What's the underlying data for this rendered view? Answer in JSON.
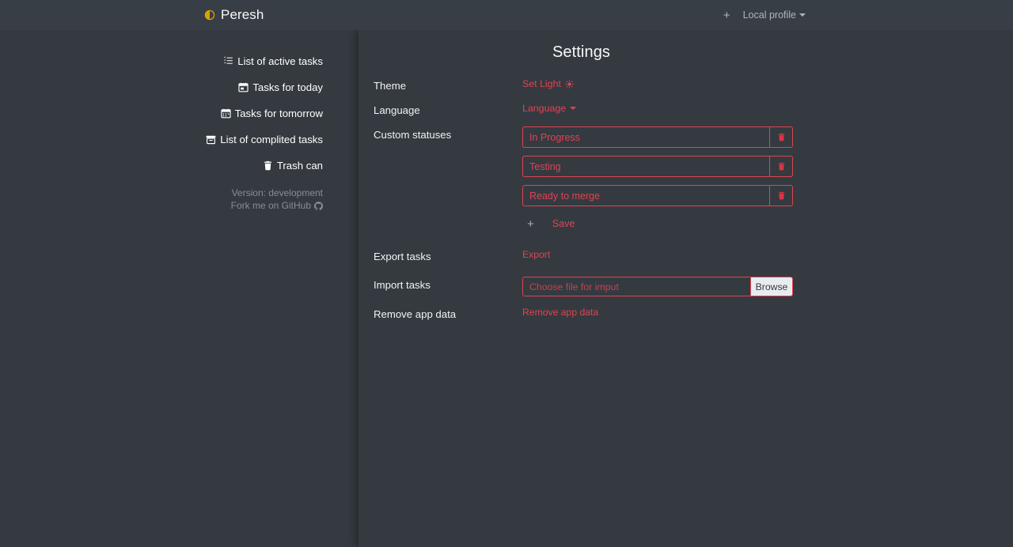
{
  "navbar": {
    "brand": "Peresh",
    "brand_icon": "adjust-circle-icon",
    "add_icon": "plus-icon",
    "profile_label": "Local profile",
    "profile_caret_icon": "caret-down-icon",
    "brand_color": "#e0a800"
  },
  "sidebar": {
    "items": [
      {
        "label": "List of active tasks",
        "icon": "list-check-icon"
      },
      {
        "label": "Tasks for today",
        "icon": "calendar-day-icon"
      },
      {
        "label": "Tasks for tomorrow",
        "icon": "calendar-icon"
      },
      {
        "label": "List of complited tasks",
        "icon": "archive-icon"
      },
      {
        "label": "Trash can",
        "icon": "trash-icon"
      }
    ],
    "version": "Version: development",
    "fork_label": "Fork me on GitHub",
    "fork_icon": "github-icon"
  },
  "settings": {
    "title": "Settings",
    "accent_color": "#e04352",
    "rows": {
      "theme_label": "Theme",
      "theme_action": "Set Light",
      "theme_icon": "sun-icon",
      "language_label": "Language",
      "language_action": "Language",
      "language_icon": "caret-down-icon",
      "statuses_label": "Custom statuses",
      "export_label": "Export tasks",
      "export_action": "Export",
      "import_label": "Import tasks",
      "import_placeholder": "Choose file for imput",
      "import_value": "",
      "browse_label": "Browse",
      "remove_label": "Remove app data",
      "remove_action": "Remove app data"
    },
    "statuses": [
      {
        "value": "In Progress",
        "delete_icon": "trash-icon"
      },
      {
        "value": "Testing",
        "delete_icon": "trash-icon"
      },
      {
        "value": "Ready to merge",
        "delete_icon": "trash-icon"
      }
    ],
    "add_label": "+",
    "save_label": "Save"
  }
}
